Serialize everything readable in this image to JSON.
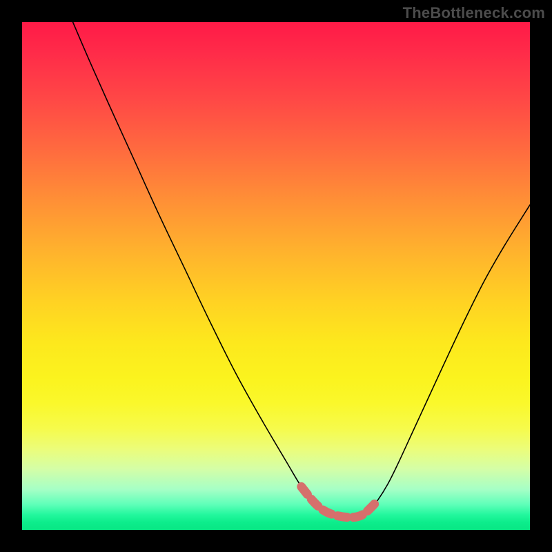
{
  "watermark": "TheBottleneck.com",
  "colors": {
    "curve": "#000000",
    "highlight": "#d66f6c",
    "background_top": "#ff1a47",
    "background_bottom": "#08e784",
    "frame": "#000000"
  },
  "chart_data": {
    "type": "line",
    "title": "",
    "xlabel": "",
    "ylabel": "",
    "xlim": [
      0,
      100
    ],
    "ylim": [
      0,
      100
    ],
    "grid": false,
    "series": [
      {
        "name": "bottleneck-curve",
        "x": [
          10,
          13,
          17,
          22,
          27,
          32,
          37,
          42,
          47,
          52,
          55,
          57,
          58.5,
          60,
          62,
          64,
          66,
          67.5,
          69,
          70,
          72,
          74,
          77,
          80,
          83,
          87,
          91,
          95,
          100
        ],
        "values": [
          100,
          93,
          84,
          73,
          62,
          51.5,
          41,
          31,
          22,
          13.5,
          8.5,
          6,
          4.5,
          3.5,
          2.8,
          2.5,
          2.6,
          3.3,
          4.7,
          5.8,
          9,
          13,
          19.5,
          26,
          32.5,
          41,
          49,
          56,
          64
        ]
      }
    ],
    "highlight": {
      "name": "optimal-region",
      "x": [
        55,
        57,
        58.5,
        60,
        62,
        64,
        66,
        67.5,
        69,
        70
      ],
      "values": [
        8.5,
        6,
        4.5,
        3.5,
        2.8,
        2.5,
        2.6,
        3.3,
        4.7,
        5.8
      ]
    }
  }
}
